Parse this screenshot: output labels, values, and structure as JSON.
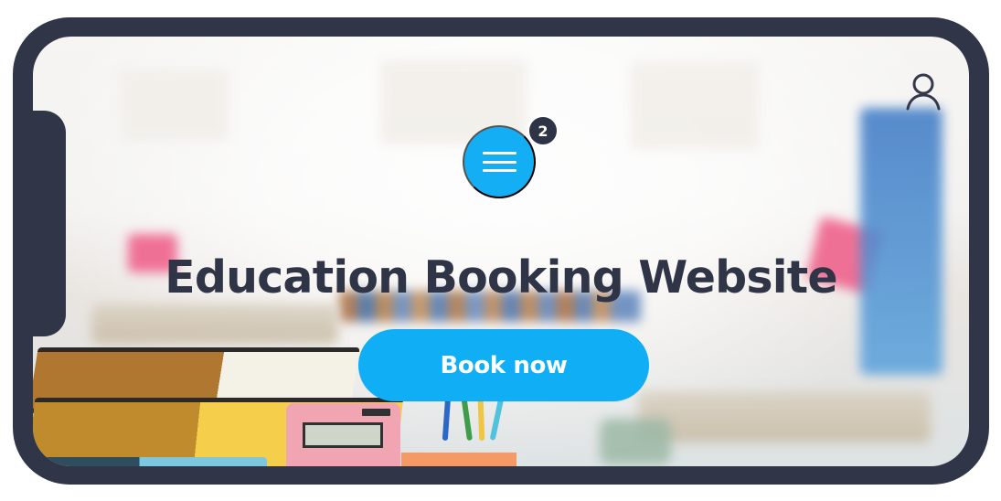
{
  "header": {
    "menu_badge_count": "2",
    "title": "Education Booking Website"
  },
  "actions": {
    "book_now_label": "Book now"
  },
  "icons": {
    "menu": "hamburger-menu-icon",
    "profile": "user-icon"
  },
  "colors": {
    "frame": "#303547",
    "accent": "#10aef4",
    "title": "#2f3446",
    "badge": "#2e3446"
  }
}
